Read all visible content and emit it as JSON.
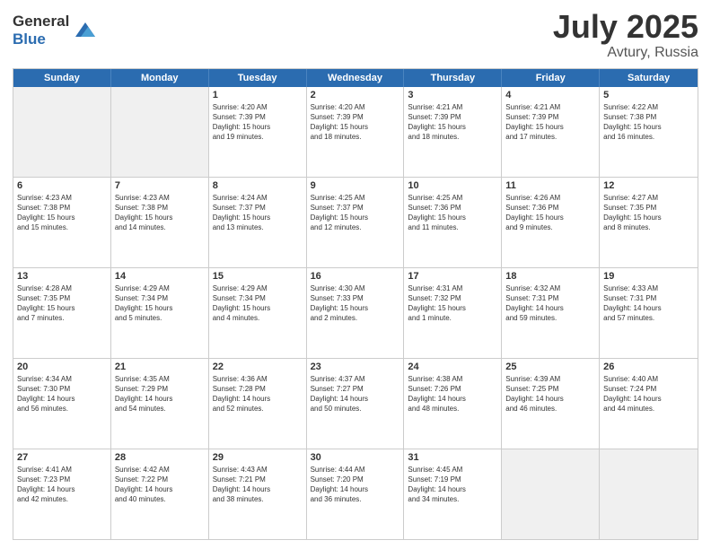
{
  "logo": {
    "general": "General",
    "blue": "Blue"
  },
  "title": "July 2025",
  "location": "Avtury, Russia",
  "header_days": [
    "Sunday",
    "Monday",
    "Tuesday",
    "Wednesday",
    "Thursday",
    "Friday",
    "Saturday"
  ],
  "weeks": [
    [
      {
        "day": "",
        "info": "",
        "empty": true
      },
      {
        "day": "",
        "info": "",
        "empty": true
      },
      {
        "day": "1",
        "info": "Sunrise: 4:20 AM\nSunset: 7:39 PM\nDaylight: 15 hours\nand 19 minutes."
      },
      {
        "day": "2",
        "info": "Sunrise: 4:20 AM\nSunset: 7:39 PM\nDaylight: 15 hours\nand 18 minutes."
      },
      {
        "day": "3",
        "info": "Sunrise: 4:21 AM\nSunset: 7:39 PM\nDaylight: 15 hours\nand 18 minutes."
      },
      {
        "day": "4",
        "info": "Sunrise: 4:21 AM\nSunset: 7:39 PM\nDaylight: 15 hours\nand 17 minutes."
      },
      {
        "day": "5",
        "info": "Sunrise: 4:22 AM\nSunset: 7:38 PM\nDaylight: 15 hours\nand 16 minutes."
      }
    ],
    [
      {
        "day": "6",
        "info": "Sunrise: 4:23 AM\nSunset: 7:38 PM\nDaylight: 15 hours\nand 15 minutes."
      },
      {
        "day": "7",
        "info": "Sunrise: 4:23 AM\nSunset: 7:38 PM\nDaylight: 15 hours\nand 14 minutes."
      },
      {
        "day": "8",
        "info": "Sunrise: 4:24 AM\nSunset: 7:37 PM\nDaylight: 15 hours\nand 13 minutes."
      },
      {
        "day": "9",
        "info": "Sunrise: 4:25 AM\nSunset: 7:37 PM\nDaylight: 15 hours\nand 12 minutes."
      },
      {
        "day": "10",
        "info": "Sunrise: 4:25 AM\nSunset: 7:36 PM\nDaylight: 15 hours\nand 11 minutes."
      },
      {
        "day": "11",
        "info": "Sunrise: 4:26 AM\nSunset: 7:36 PM\nDaylight: 15 hours\nand 9 minutes."
      },
      {
        "day": "12",
        "info": "Sunrise: 4:27 AM\nSunset: 7:35 PM\nDaylight: 15 hours\nand 8 minutes."
      }
    ],
    [
      {
        "day": "13",
        "info": "Sunrise: 4:28 AM\nSunset: 7:35 PM\nDaylight: 15 hours\nand 7 minutes."
      },
      {
        "day": "14",
        "info": "Sunrise: 4:29 AM\nSunset: 7:34 PM\nDaylight: 15 hours\nand 5 minutes."
      },
      {
        "day": "15",
        "info": "Sunrise: 4:29 AM\nSunset: 7:34 PM\nDaylight: 15 hours\nand 4 minutes."
      },
      {
        "day": "16",
        "info": "Sunrise: 4:30 AM\nSunset: 7:33 PM\nDaylight: 15 hours\nand 2 minutes."
      },
      {
        "day": "17",
        "info": "Sunrise: 4:31 AM\nSunset: 7:32 PM\nDaylight: 15 hours\nand 1 minute."
      },
      {
        "day": "18",
        "info": "Sunrise: 4:32 AM\nSunset: 7:31 PM\nDaylight: 14 hours\nand 59 minutes."
      },
      {
        "day": "19",
        "info": "Sunrise: 4:33 AM\nSunset: 7:31 PM\nDaylight: 14 hours\nand 57 minutes."
      }
    ],
    [
      {
        "day": "20",
        "info": "Sunrise: 4:34 AM\nSunset: 7:30 PM\nDaylight: 14 hours\nand 56 minutes."
      },
      {
        "day": "21",
        "info": "Sunrise: 4:35 AM\nSunset: 7:29 PM\nDaylight: 14 hours\nand 54 minutes."
      },
      {
        "day": "22",
        "info": "Sunrise: 4:36 AM\nSunset: 7:28 PM\nDaylight: 14 hours\nand 52 minutes."
      },
      {
        "day": "23",
        "info": "Sunrise: 4:37 AM\nSunset: 7:27 PM\nDaylight: 14 hours\nand 50 minutes."
      },
      {
        "day": "24",
        "info": "Sunrise: 4:38 AM\nSunset: 7:26 PM\nDaylight: 14 hours\nand 48 minutes."
      },
      {
        "day": "25",
        "info": "Sunrise: 4:39 AM\nSunset: 7:25 PM\nDaylight: 14 hours\nand 46 minutes."
      },
      {
        "day": "26",
        "info": "Sunrise: 4:40 AM\nSunset: 7:24 PM\nDaylight: 14 hours\nand 44 minutes."
      }
    ],
    [
      {
        "day": "27",
        "info": "Sunrise: 4:41 AM\nSunset: 7:23 PM\nDaylight: 14 hours\nand 42 minutes."
      },
      {
        "day": "28",
        "info": "Sunrise: 4:42 AM\nSunset: 7:22 PM\nDaylight: 14 hours\nand 40 minutes."
      },
      {
        "day": "29",
        "info": "Sunrise: 4:43 AM\nSunset: 7:21 PM\nDaylight: 14 hours\nand 38 minutes."
      },
      {
        "day": "30",
        "info": "Sunrise: 4:44 AM\nSunset: 7:20 PM\nDaylight: 14 hours\nand 36 minutes."
      },
      {
        "day": "31",
        "info": "Sunrise: 4:45 AM\nSunset: 7:19 PM\nDaylight: 14 hours\nand 34 minutes."
      },
      {
        "day": "",
        "info": "",
        "empty": true
      },
      {
        "day": "",
        "info": "",
        "empty": true
      }
    ]
  ]
}
